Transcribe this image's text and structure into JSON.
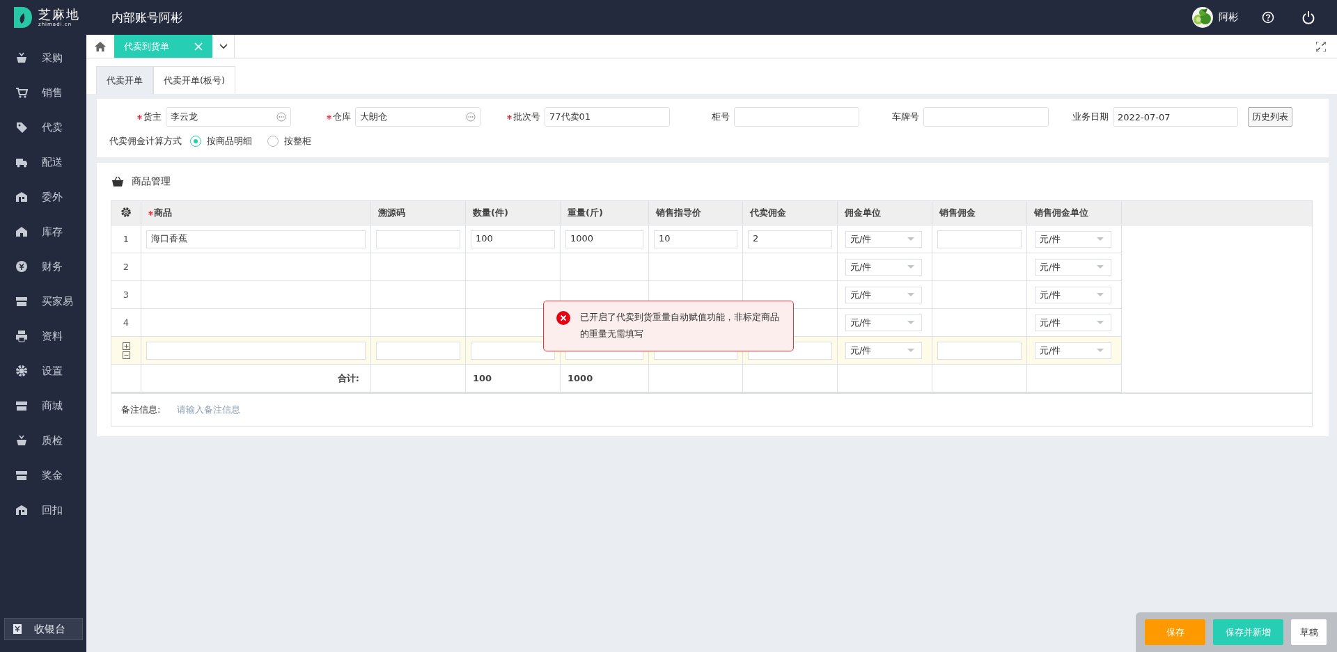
{
  "header": {
    "logo": {
      "name": "芝麻地",
      "domain": "zhimadi.cn"
    },
    "title": "内部账号阿彬",
    "user": "阿彬"
  },
  "sidebar": {
    "items": [
      {
        "label": "采购"
      },
      {
        "label": "销售"
      },
      {
        "label": "代卖"
      },
      {
        "label": "配送"
      },
      {
        "label": "委外"
      },
      {
        "label": "库存"
      },
      {
        "label": "财务"
      },
      {
        "label": "买家易"
      },
      {
        "label": "资料"
      },
      {
        "label": "设置"
      },
      {
        "label": "商城"
      },
      {
        "label": "质检"
      },
      {
        "label": "奖金"
      },
      {
        "label": "回扣"
      }
    ],
    "footer_button": "收银台"
  },
  "page_tabs": [
    {
      "label": "代卖到货单",
      "selected": true
    }
  ],
  "sub_tabs": [
    {
      "label": "代卖开单",
      "selected": true
    },
    {
      "label": "代卖开单(板号)",
      "selected": false
    }
  ],
  "form": {
    "fields": [
      {
        "label": "货主",
        "required": true,
        "value": "李云龙",
        "kind": "picker"
      },
      {
        "label": "仓库",
        "required": true,
        "value": "大朗仓",
        "kind": "picker"
      },
      {
        "label": "批次号",
        "required": true,
        "value": "77代卖01",
        "kind": "text"
      },
      {
        "label": "柜号",
        "required": false,
        "kind": "text"
      },
      {
        "label": "车牌号",
        "required": false,
        "kind": "text"
      },
      {
        "label": "业务日期",
        "required": false,
        "value": "2022-07-07",
        "kind": "text"
      }
    ],
    "history_button": "历史列表",
    "commission_method": {
      "label": "代卖佣金计算方式",
      "options": [
        {
          "label": "按商品明细",
          "selected": true
        },
        {
          "label": "按整柜",
          "selected": false
        }
      ]
    }
  },
  "goods": {
    "title": "商品管理",
    "columns": [
      {
        "label": "商品",
        "required": true
      },
      {
        "label": "溯源码",
        "required": false
      },
      {
        "label": "数量(件)",
        "required": false
      },
      {
        "label": "重量(斤)",
        "required": false
      },
      {
        "label": "销售指导价",
        "required": false
      },
      {
        "label": "代卖佣金",
        "required": false
      },
      {
        "label": "佣金单位",
        "required": false
      },
      {
        "label": "销售佣金",
        "required": false
      },
      {
        "label": "销售佣金单位",
        "required": false
      }
    ],
    "rows": [
      {
        "kind": "data",
        "number": "1",
        "cells": [
          {
            "kind": "input",
            "value": "海口香蕉"
          },
          {
            "kind": "input"
          },
          {
            "kind": "input",
            "value": "100"
          },
          {
            "kind": "input",
            "value": "1000"
          },
          {
            "kind": "input",
            "value": "10"
          },
          {
            "kind": "input",
            "value": "2"
          },
          {
            "kind": "select",
            "value": "元/件"
          },
          {
            "kind": "input"
          },
          {
            "kind": "select",
            "value": "元/件"
          }
        ]
      },
      {
        "kind": "data",
        "number": "2",
        "cells": [
          {
            "kind": "blank"
          },
          {
            "kind": "blank"
          },
          {
            "kind": "blank"
          },
          {
            "kind": "blank"
          },
          {
            "kind": "blank"
          },
          {
            "kind": "blank"
          },
          {
            "kind": "select",
            "value": "元/件"
          },
          {
            "kind": "blank"
          },
          {
            "kind": "select",
            "value": "元/件"
          }
        ]
      },
      {
        "kind": "data",
        "number": "3",
        "cells": [
          {
            "kind": "blank"
          },
          {
            "kind": "blank"
          },
          {
            "kind": "blank"
          },
          {
            "kind": "blank"
          },
          {
            "kind": "blank"
          },
          {
            "kind": "blank"
          },
          {
            "kind": "select",
            "value": "元/件"
          },
          {
            "kind": "blank"
          },
          {
            "kind": "select",
            "value": "元/件"
          }
        ]
      },
      {
        "kind": "data",
        "number": "4",
        "cells": [
          {
            "kind": "blank"
          },
          {
            "kind": "blank"
          },
          {
            "kind": "blank"
          },
          {
            "kind": "blank"
          },
          {
            "kind": "blank"
          },
          {
            "kind": "blank"
          },
          {
            "kind": "select",
            "value": "元/件"
          },
          {
            "kind": "blank"
          },
          {
            "kind": "select",
            "value": "元/件"
          }
        ]
      },
      {
        "kind": "new",
        "cells": [
          {
            "kind": "input"
          },
          {
            "kind": "input"
          },
          {
            "kind": "input"
          },
          {
            "kind": "input"
          },
          {
            "kind": "input"
          },
          {
            "kind": "input"
          },
          {
            "kind": "select",
            "value": "元/件"
          },
          {
            "kind": "input"
          },
          {
            "kind": "select",
            "value": "元/件"
          }
        ]
      }
    ],
    "total_row": {
      "label": "合计:",
      "cells": [
        {
          "kind": "blank"
        },
        {
          "kind": "sum",
          "value": "100"
        },
        {
          "kind": "sum",
          "value": "1000"
        },
        {
          "kind": "blank"
        },
        {
          "kind": "blank"
        },
        {
          "kind": "blank"
        },
        {
          "kind": "blank"
        },
        {
          "kind": "blank"
        }
      ]
    },
    "remark": {
      "label": "备注信息:",
      "placeholder": "请输入备注信息"
    }
  },
  "toast": {
    "kind": "error",
    "message": "已开启了代卖到货重量自动赋值功能，非标定商品的重量无需填写"
  },
  "actions": [
    {
      "label": "保存",
      "kind": "primary"
    },
    {
      "label": "保存并新增",
      "kind": "success"
    },
    {
      "label": "草稿",
      "kind": "default"
    }
  ]
}
